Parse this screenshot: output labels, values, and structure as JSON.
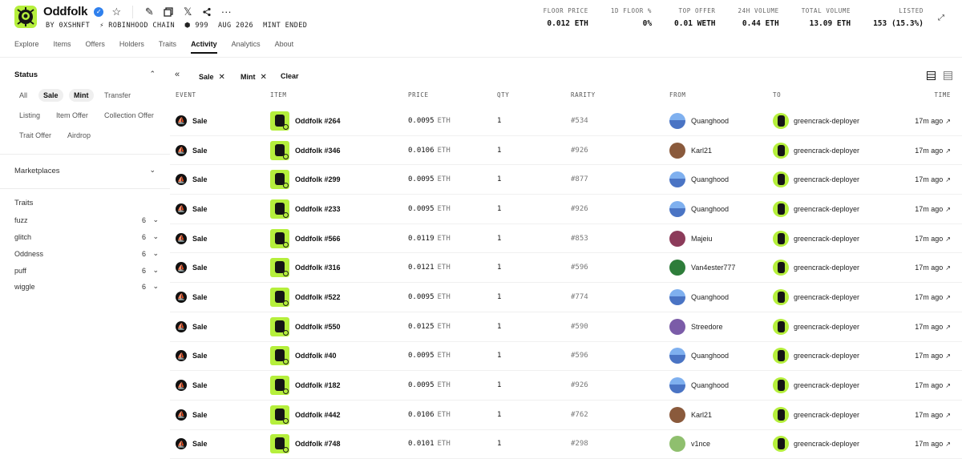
{
  "collection": {
    "name": "Oddfolk",
    "verified_icon": "verified-check-icon",
    "meta": [
      "BY 0XSHNFT",
      "ROBINHOOD CHAIN",
      "999",
      "AUG 2026",
      "MINT ENDED"
    ]
  },
  "tabs": [
    "Explore",
    "Items",
    "Offers",
    "Holders",
    "Traits",
    "Activity",
    "Analytics",
    "About"
  ],
  "active_tab": "Activity",
  "stats": [
    {
      "label": "FLOOR PRICE",
      "value": "0.012 ETH"
    },
    {
      "label": "1D FLOOR %",
      "value": "0%"
    },
    {
      "label": "TOP OFFER",
      "value": "0.01 WETH"
    },
    {
      "label": "24H VOLUME",
      "value": "0.44 ETH"
    },
    {
      "label": "TOTAL VOLUME",
      "value": "13.09 ETH"
    },
    {
      "label": "LISTED",
      "value": "153 (15.3%)"
    }
  ],
  "sidebar": {
    "status_title": "Status",
    "status_chips": [
      "All",
      "Sale",
      "Mint",
      "Transfer",
      "Listing",
      "Item Offer",
      "Collection Offer",
      "Trait Offer",
      "Airdrop"
    ],
    "active_chips": [
      "Sale",
      "Mint"
    ],
    "marketplaces_title": "Marketplaces",
    "traits_title": "Traits",
    "traits": [
      {
        "name": "fuzz",
        "count": "6"
      },
      {
        "name": "glitch",
        "count": "6"
      },
      {
        "name": "Oddness",
        "count": "6"
      },
      {
        "name": "puff",
        "count": "6"
      },
      {
        "name": "wiggle",
        "count": "6"
      }
    ]
  },
  "filters": {
    "applied": [
      "Sale",
      "Mint"
    ],
    "clear_label": "Clear"
  },
  "table": {
    "headers": [
      "EVENT",
      "ITEM",
      "PRICE",
      "QTY",
      "RARITY",
      "FROM",
      "TO",
      "TIME"
    ],
    "rows": [
      {
        "event": "Sale",
        "item": "Oddfolk #264",
        "price": "0.0095",
        "currency": "ETH",
        "qty": "1",
        "rarity": "#534",
        "from": "Quanghood",
        "to": "greencrack-deployer",
        "time": "17m ago"
      },
      {
        "event": "Sale",
        "item": "Oddfolk #346",
        "price": "0.0106",
        "currency": "ETH",
        "qty": "1",
        "rarity": "#926",
        "from": "Karl21",
        "to": "greencrack-deployer",
        "time": "17m ago"
      },
      {
        "event": "Sale",
        "item": "Oddfolk #299",
        "price": "0.0095",
        "currency": "ETH",
        "qty": "1",
        "rarity": "#877",
        "from": "Quanghood",
        "to": "greencrack-deployer",
        "time": "17m ago"
      },
      {
        "event": "Sale",
        "item": "Oddfolk #233",
        "price": "0.0095",
        "currency": "ETH",
        "qty": "1",
        "rarity": "#926",
        "from": "Quanghood",
        "to": "greencrack-deployer",
        "time": "17m ago"
      },
      {
        "event": "Sale",
        "item": "Oddfolk #566",
        "price": "0.0119",
        "currency": "ETH",
        "qty": "1",
        "rarity": "#853",
        "from": "Majeiu",
        "to": "greencrack-deployer",
        "time": "17m ago"
      },
      {
        "event": "Sale",
        "item": "Oddfolk #316",
        "price": "0.0121",
        "currency": "ETH",
        "qty": "1",
        "rarity": "#596",
        "from": "Van4ester777",
        "to": "greencrack-deployer",
        "time": "17m ago"
      },
      {
        "event": "Sale",
        "item": "Oddfolk #522",
        "price": "0.0095",
        "currency": "ETH",
        "qty": "1",
        "rarity": "#774",
        "from": "Quanghood",
        "to": "greencrack-deployer",
        "time": "17m ago"
      },
      {
        "event": "Sale",
        "item": "Oddfolk #550",
        "price": "0.0125",
        "currency": "ETH",
        "qty": "1",
        "rarity": "#590",
        "from": "Streedore",
        "to": "greencrack-deployer",
        "time": "17m ago"
      },
      {
        "event": "Sale",
        "item": "Oddfolk #40",
        "price": "0.0095",
        "currency": "ETH",
        "qty": "1",
        "rarity": "#596",
        "from": "Quanghood",
        "to": "greencrack-deployer",
        "time": "17m ago"
      },
      {
        "event": "Sale",
        "item": "Oddfolk #182",
        "price": "0.0095",
        "currency": "ETH",
        "qty": "1",
        "rarity": "#926",
        "from": "Quanghood",
        "to": "greencrack-deployer",
        "time": "17m ago"
      },
      {
        "event": "Sale",
        "item": "Oddfolk #442",
        "price": "0.0106",
        "currency": "ETH",
        "qty": "1",
        "rarity": "#762",
        "from": "Karl21",
        "to": "greencrack-deployer",
        "time": "17m ago"
      },
      {
        "event": "Sale",
        "item": "Oddfolk #748",
        "price": "0.0101",
        "currency": "ETH",
        "qty": "1",
        "rarity": "#298",
        "from": "v1nce",
        "to": "greencrack-deployer",
        "time": "17m ago"
      }
    ]
  },
  "colors": {
    "brand_green": "#b5ef3c",
    "avatar_quanghood": "#5b8fd8",
    "avatar_karl21": "#8a5a3c",
    "avatar_majeiu": "#8c3b5a",
    "avatar_van4ester777": "#2e7d3a",
    "avatar_streedore": "#7b5ca8",
    "avatar_v1nce": "#8fbf6e"
  }
}
